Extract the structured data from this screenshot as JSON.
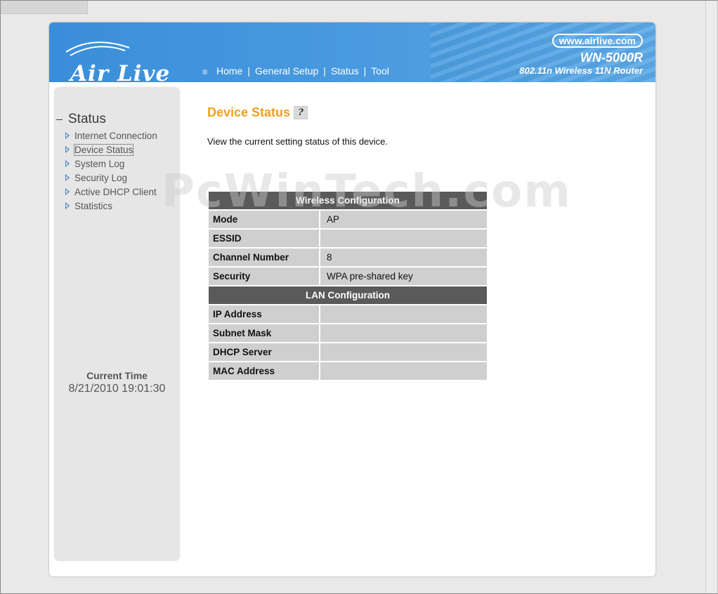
{
  "brand": {
    "logo_text": "Air Live",
    "reg_mark": "®",
    "site_url": "www.airlive.com",
    "model": "WN-5000R",
    "tagline": "802.11n Wireless 11N Router"
  },
  "nav": {
    "items": [
      {
        "label": "Home"
      },
      {
        "label": "General Setup"
      },
      {
        "label": "Status"
      },
      {
        "label": "Tool"
      }
    ],
    "separator": "|"
  },
  "sidebar": {
    "section_title": "Status",
    "items": [
      {
        "label": "Internet Connection"
      },
      {
        "label": "Device Status"
      },
      {
        "label": "System Log"
      },
      {
        "label": "Security Log"
      },
      {
        "label": "Active DHCP Client"
      },
      {
        "label": "Statistics"
      }
    ],
    "time_label": "Current Time",
    "time_value": "8/21/2010 19:01:30"
  },
  "main": {
    "title": "Device Status",
    "help_glyph": "?",
    "description": "View the current setting status of this device.",
    "wireless": {
      "header": "Wireless Configuration",
      "rows": [
        {
          "key": "Mode",
          "value": "AP"
        },
        {
          "key": "ESSID",
          "value": ""
        },
        {
          "key": "Channel Number",
          "value": "8"
        },
        {
          "key": "Security",
          "value": "WPA pre-shared key"
        }
      ]
    },
    "lan": {
      "header": "LAN Configuration",
      "rows": [
        {
          "key": "IP Address",
          "value": ""
        },
        {
          "key": "Subnet Mask",
          "value": ""
        },
        {
          "key": "DHCP Server",
          "value": ""
        },
        {
          "key": "MAC Address",
          "value": ""
        }
      ]
    }
  },
  "watermark": "PcWinTech.com",
  "colors": {
    "header_blue": "#3a8ed9",
    "title_orange": "#f0a020",
    "table_header": "#5a5a5a",
    "table_cell": "#cfcfcf"
  }
}
